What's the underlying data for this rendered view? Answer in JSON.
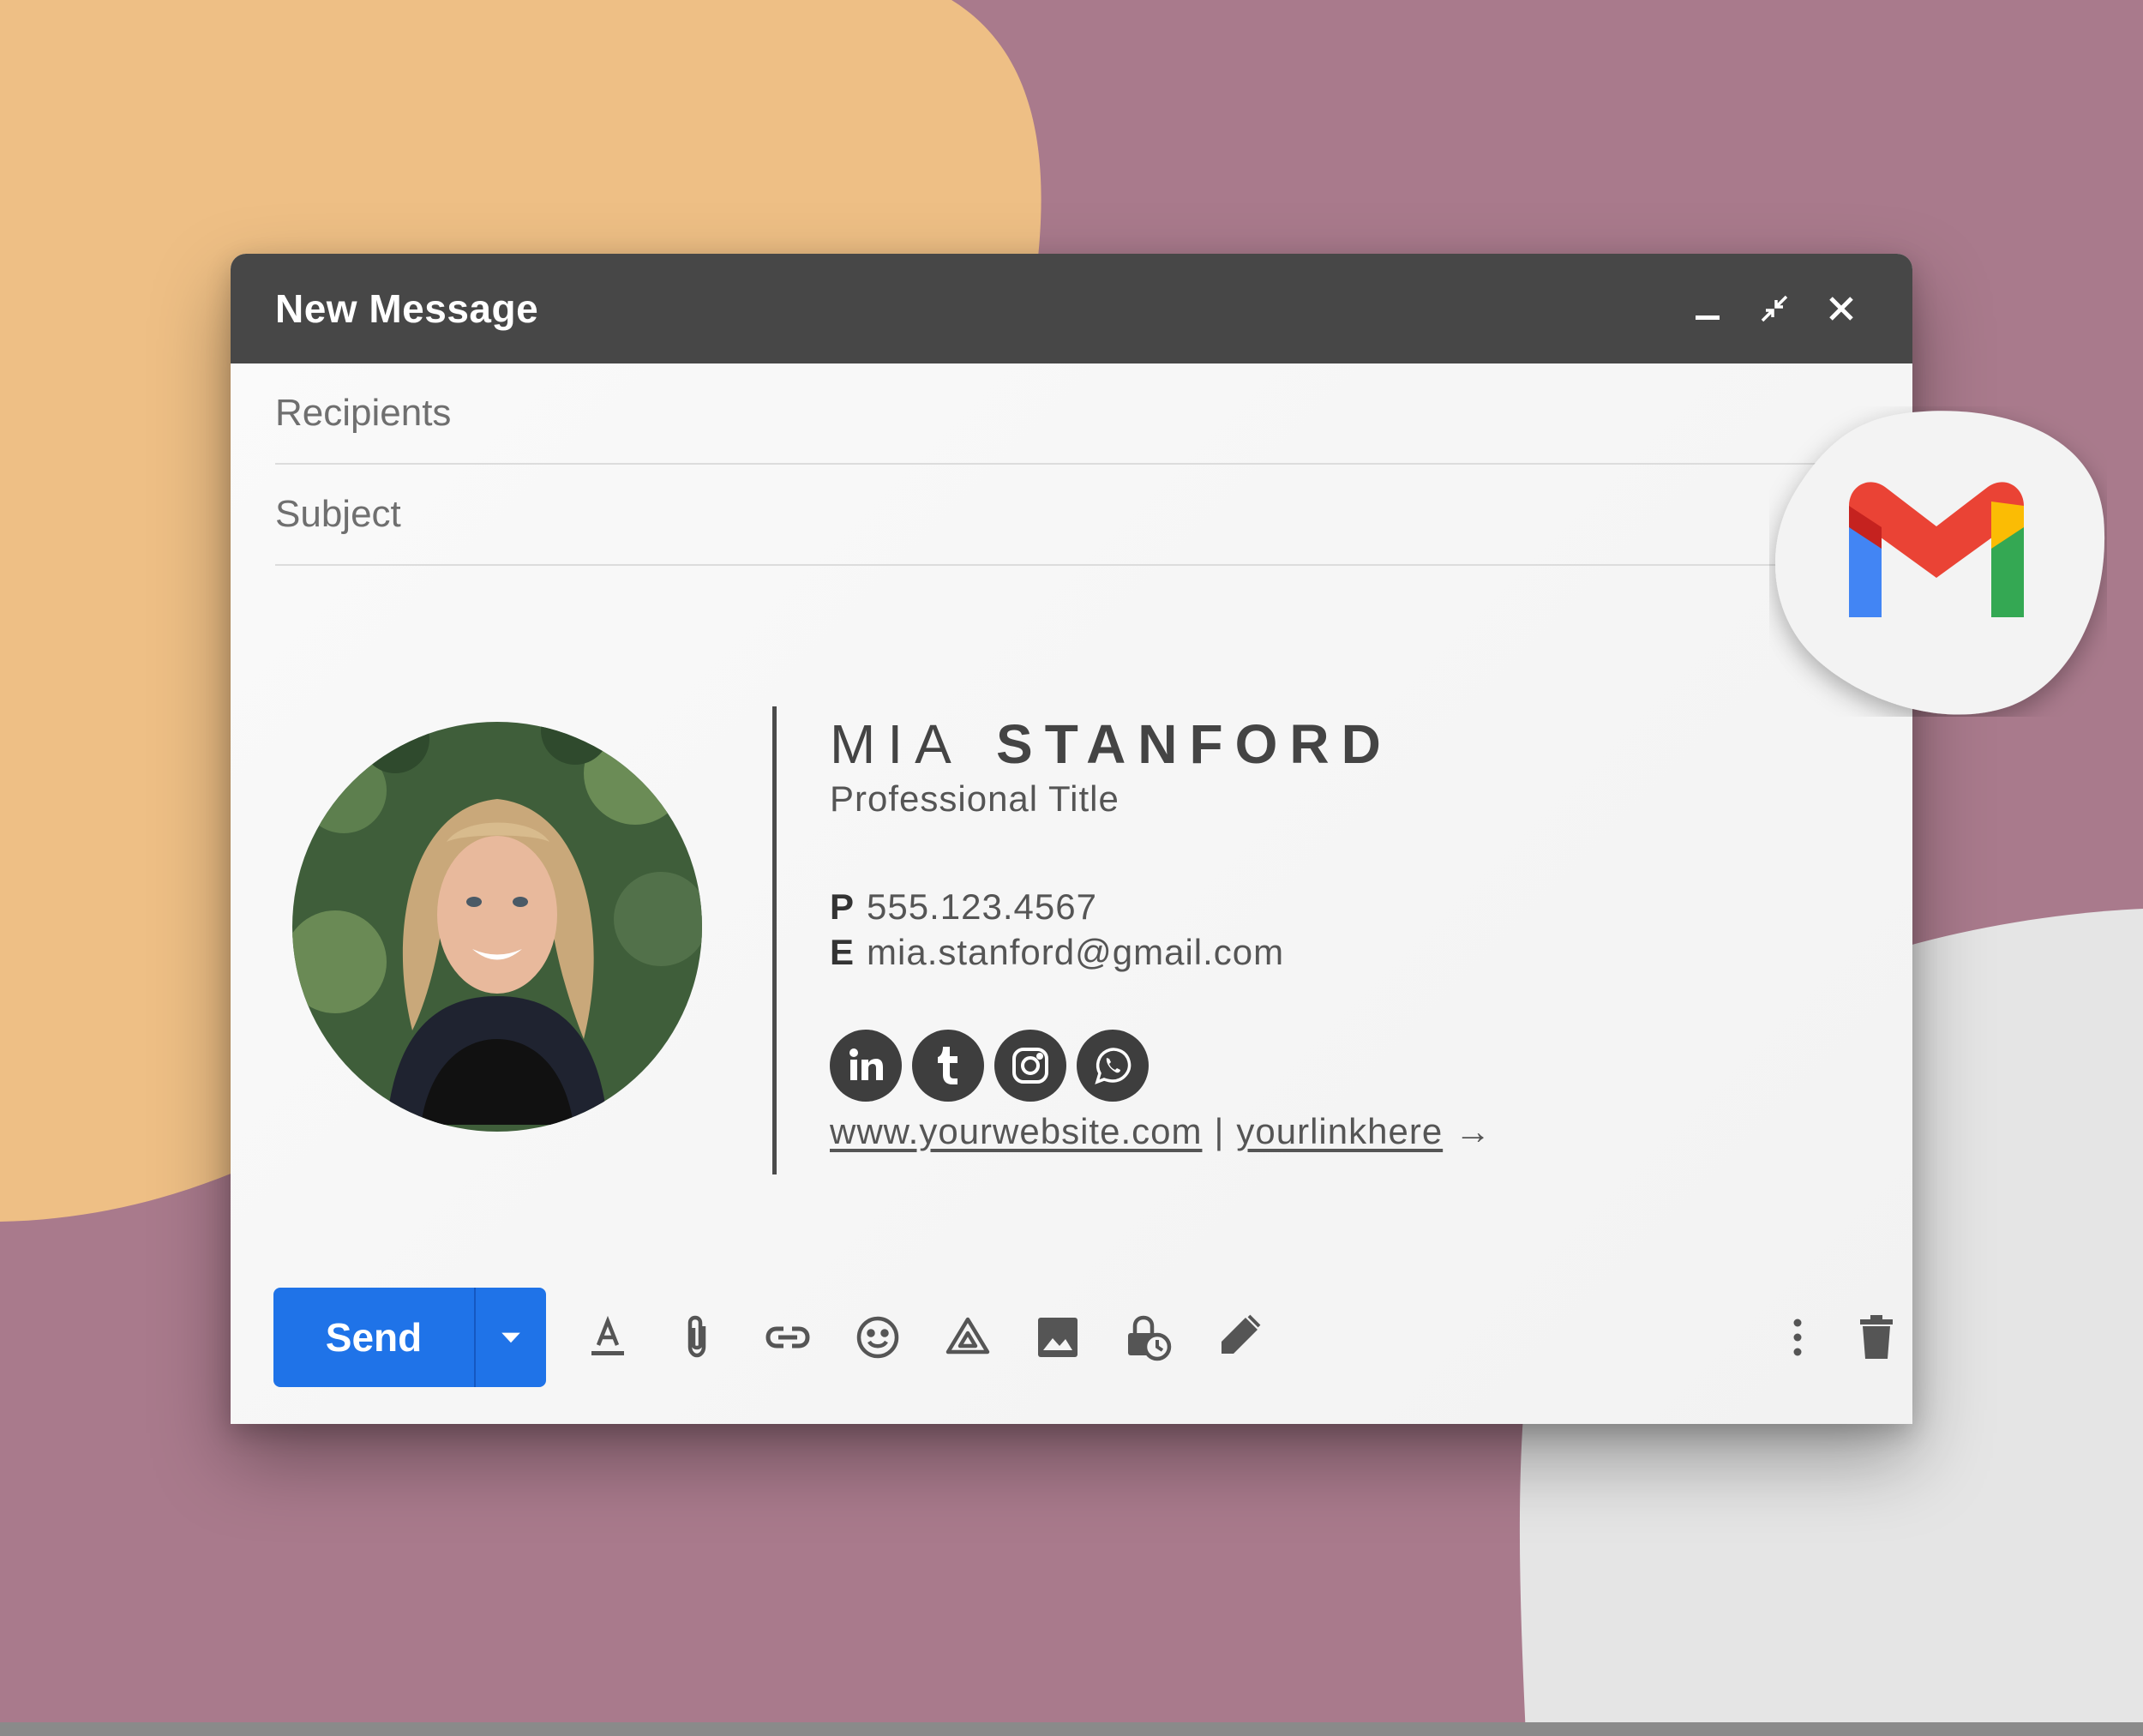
{
  "window": {
    "title": "New Message"
  },
  "fields": {
    "recipients_placeholder": "Recipients",
    "subject_placeholder": "Subject"
  },
  "signature": {
    "first_name": "MIA",
    "last_name": "STANFORD",
    "title": "Professional Title",
    "phone_label": "P",
    "phone": "555.123.4567",
    "email_label": "E",
    "email": "mia.stanford@gmail.com",
    "socials": [
      "linkedin-icon",
      "tumblr-icon",
      "instagram-icon",
      "whatsapp-icon"
    ],
    "website": "www.yourwebsite.com",
    "separator": "|",
    "link": "yourlinkhere",
    "arrow": "→"
  },
  "toolbar": {
    "send_label": "Send",
    "tools": [
      "formatting-icon",
      "attach-icon",
      "link-icon",
      "emoji-icon",
      "drive-icon",
      "photo-icon",
      "confidential-mode-icon",
      "signature-icon"
    ],
    "right_tools": [
      "more-options-icon",
      "delete-icon"
    ]
  },
  "colors": {
    "background": "#a97a8c",
    "accent_peach": "#eebf85",
    "titlebar": "#474747",
    "send": "#1f73e8",
    "signature_text": "#444444",
    "gmail_red": "#ea4335",
    "gmail_blue": "#4285f4",
    "gmail_green": "#34a853",
    "gmail_yellow": "#fbbc04"
  }
}
